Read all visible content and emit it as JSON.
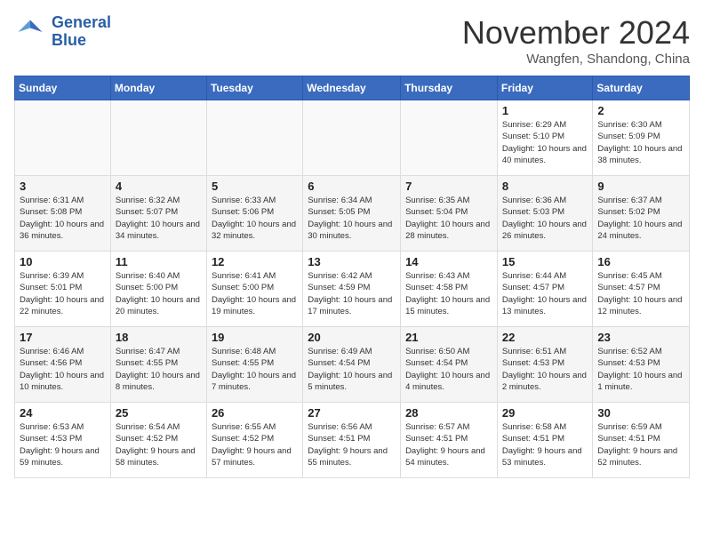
{
  "header": {
    "logo_line1": "General",
    "logo_line2": "Blue",
    "month": "November 2024",
    "location": "Wangfen, Shandong, China"
  },
  "weekdays": [
    "Sunday",
    "Monday",
    "Tuesday",
    "Wednesday",
    "Thursday",
    "Friday",
    "Saturday"
  ],
  "weeks": [
    [
      {
        "day": "",
        "info": ""
      },
      {
        "day": "",
        "info": ""
      },
      {
        "day": "",
        "info": ""
      },
      {
        "day": "",
        "info": ""
      },
      {
        "day": "",
        "info": ""
      },
      {
        "day": "1",
        "info": "Sunrise: 6:29 AM\nSunset: 5:10 PM\nDaylight: 10 hours and 40 minutes."
      },
      {
        "day": "2",
        "info": "Sunrise: 6:30 AM\nSunset: 5:09 PM\nDaylight: 10 hours and 38 minutes."
      }
    ],
    [
      {
        "day": "3",
        "info": "Sunrise: 6:31 AM\nSunset: 5:08 PM\nDaylight: 10 hours and 36 minutes."
      },
      {
        "day": "4",
        "info": "Sunrise: 6:32 AM\nSunset: 5:07 PM\nDaylight: 10 hours and 34 minutes."
      },
      {
        "day": "5",
        "info": "Sunrise: 6:33 AM\nSunset: 5:06 PM\nDaylight: 10 hours and 32 minutes."
      },
      {
        "day": "6",
        "info": "Sunrise: 6:34 AM\nSunset: 5:05 PM\nDaylight: 10 hours and 30 minutes."
      },
      {
        "day": "7",
        "info": "Sunrise: 6:35 AM\nSunset: 5:04 PM\nDaylight: 10 hours and 28 minutes."
      },
      {
        "day": "8",
        "info": "Sunrise: 6:36 AM\nSunset: 5:03 PM\nDaylight: 10 hours and 26 minutes."
      },
      {
        "day": "9",
        "info": "Sunrise: 6:37 AM\nSunset: 5:02 PM\nDaylight: 10 hours and 24 minutes."
      }
    ],
    [
      {
        "day": "10",
        "info": "Sunrise: 6:39 AM\nSunset: 5:01 PM\nDaylight: 10 hours and 22 minutes."
      },
      {
        "day": "11",
        "info": "Sunrise: 6:40 AM\nSunset: 5:00 PM\nDaylight: 10 hours and 20 minutes."
      },
      {
        "day": "12",
        "info": "Sunrise: 6:41 AM\nSunset: 5:00 PM\nDaylight: 10 hours and 19 minutes."
      },
      {
        "day": "13",
        "info": "Sunrise: 6:42 AM\nSunset: 4:59 PM\nDaylight: 10 hours and 17 minutes."
      },
      {
        "day": "14",
        "info": "Sunrise: 6:43 AM\nSunset: 4:58 PM\nDaylight: 10 hours and 15 minutes."
      },
      {
        "day": "15",
        "info": "Sunrise: 6:44 AM\nSunset: 4:57 PM\nDaylight: 10 hours and 13 minutes."
      },
      {
        "day": "16",
        "info": "Sunrise: 6:45 AM\nSunset: 4:57 PM\nDaylight: 10 hours and 12 minutes."
      }
    ],
    [
      {
        "day": "17",
        "info": "Sunrise: 6:46 AM\nSunset: 4:56 PM\nDaylight: 10 hours and 10 minutes."
      },
      {
        "day": "18",
        "info": "Sunrise: 6:47 AM\nSunset: 4:55 PM\nDaylight: 10 hours and 8 minutes."
      },
      {
        "day": "19",
        "info": "Sunrise: 6:48 AM\nSunset: 4:55 PM\nDaylight: 10 hours and 7 minutes."
      },
      {
        "day": "20",
        "info": "Sunrise: 6:49 AM\nSunset: 4:54 PM\nDaylight: 10 hours and 5 minutes."
      },
      {
        "day": "21",
        "info": "Sunrise: 6:50 AM\nSunset: 4:54 PM\nDaylight: 10 hours and 4 minutes."
      },
      {
        "day": "22",
        "info": "Sunrise: 6:51 AM\nSunset: 4:53 PM\nDaylight: 10 hours and 2 minutes."
      },
      {
        "day": "23",
        "info": "Sunrise: 6:52 AM\nSunset: 4:53 PM\nDaylight: 10 hours and 1 minute."
      }
    ],
    [
      {
        "day": "24",
        "info": "Sunrise: 6:53 AM\nSunset: 4:53 PM\nDaylight: 9 hours and 59 minutes."
      },
      {
        "day": "25",
        "info": "Sunrise: 6:54 AM\nSunset: 4:52 PM\nDaylight: 9 hours and 58 minutes."
      },
      {
        "day": "26",
        "info": "Sunrise: 6:55 AM\nSunset: 4:52 PM\nDaylight: 9 hours and 57 minutes."
      },
      {
        "day": "27",
        "info": "Sunrise: 6:56 AM\nSunset: 4:51 PM\nDaylight: 9 hours and 55 minutes."
      },
      {
        "day": "28",
        "info": "Sunrise: 6:57 AM\nSunset: 4:51 PM\nDaylight: 9 hours and 54 minutes."
      },
      {
        "day": "29",
        "info": "Sunrise: 6:58 AM\nSunset: 4:51 PM\nDaylight: 9 hours and 53 minutes."
      },
      {
        "day": "30",
        "info": "Sunrise: 6:59 AM\nSunset: 4:51 PM\nDaylight: 9 hours and 52 minutes."
      }
    ]
  ]
}
